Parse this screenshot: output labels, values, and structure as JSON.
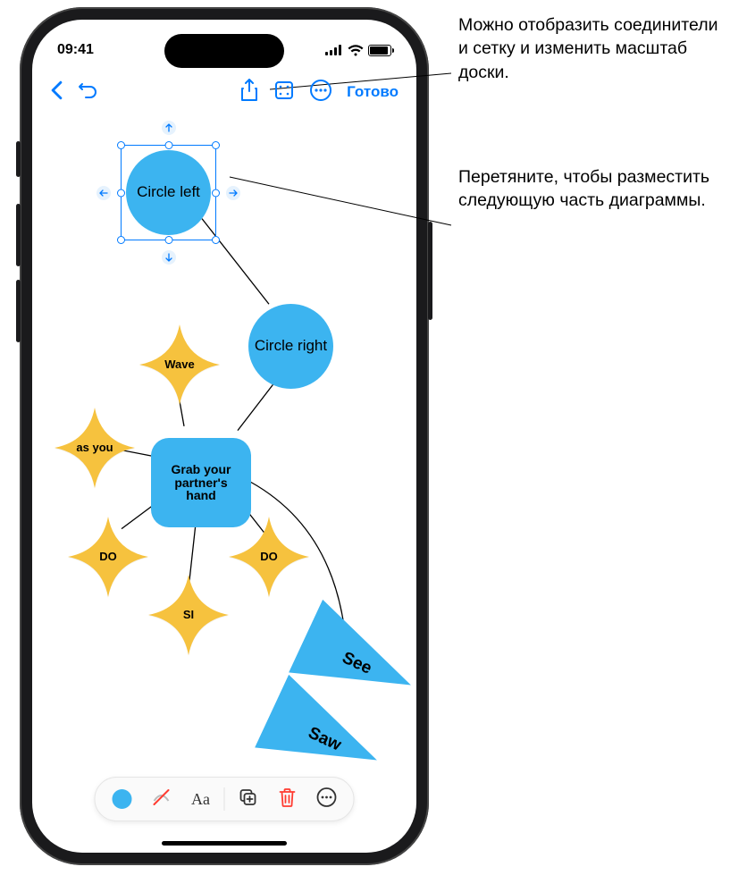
{
  "status": {
    "time": "09:41"
  },
  "toolbar": {
    "done_label": "Готово"
  },
  "shapes": {
    "circle_left": "Circle left",
    "circle_right": "Circle right",
    "star_wave": "Wave",
    "star_asyou": "as you",
    "star_do_left": "DO",
    "star_si": "SI",
    "star_do_right": "DO",
    "square_grab": "Grab your partner's hand",
    "tri_see": "See",
    "tri_saw": "Saw"
  },
  "callouts": {
    "board_options": "Можно отобразить соединители и сетку и изменить масштаб доски.",
    "drag_handle": "Перетяните, чтобы разместить следующую часть диаграммы."
  },
  "icons": {
    "back": "back-icon",
    "undo": "undo-icon",
    "share": "share-icon",
    "board": "board-options-icon",
    "more": "more-icon",
    "fill": "fill-color-icon",
    "noline": "no-line-icon",
    "text": "text-format-icon",
    "copy": "copy-icon",
    "delete": "delete-icon",
    "overflow": "overflow-icon"
  },
  "colors": {
    "accent": "#007aff",
    "shape_blue": "#3cb4f0",
    "shape_yellow": "#f6c23e",
    "danger": "#ff3b30"
  }
}
